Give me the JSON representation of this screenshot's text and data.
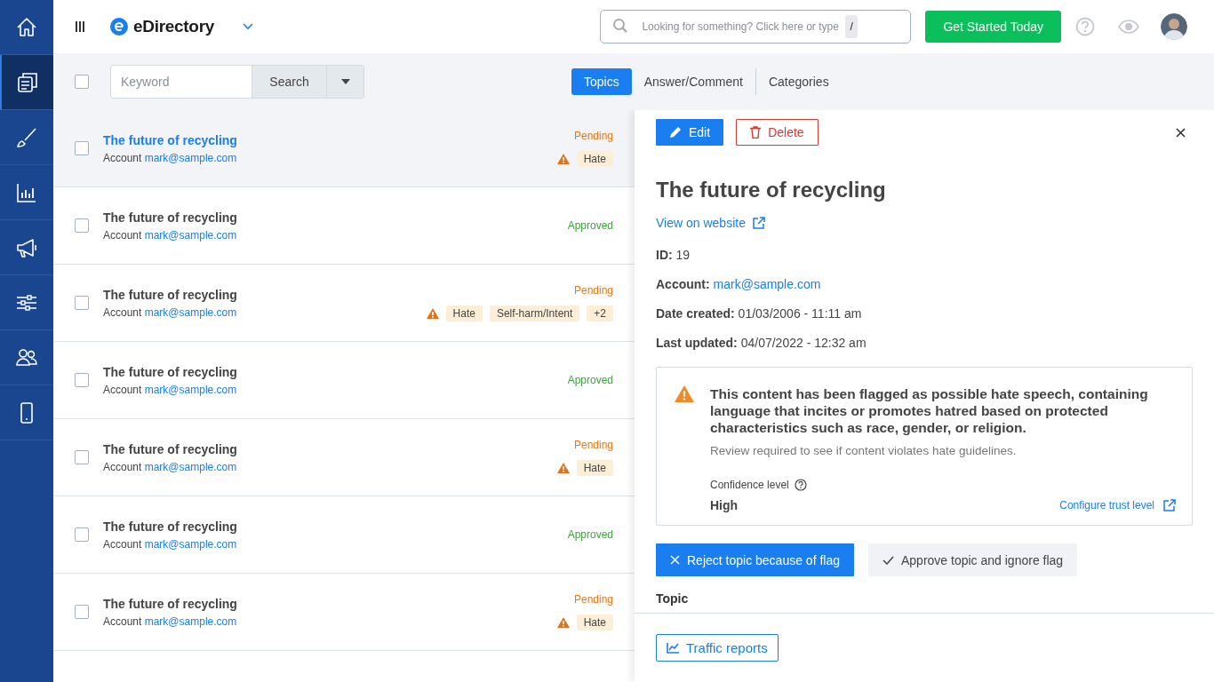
{
  "sidebar": {
    "items": [
      {
        "kind": "home",
        "selected": false
      },
      {
        "kind": "documents",
        "selected": true
      },
      {
        "kind": "brush",
        "selected": false
      },
      {
        "kind": "chart",
        "selected": false
      },
      {
        "kind": "megaphone",
        "selected": false
      },
      {
        "kind": "sliders",
        "selected": false
      },
      {
        "kind": "users",
        "selected": false
      },
      {
        "kind": "tablet",
        "selected": false
      }
    ]
  },
  "topbar": {
    "brand": "eDirectory",
    "search": {
      "placeholder": "Looking for something? Click here or type",
      "shortcut": "/"
    },
    "cta": "Get Started Today"
  },
  "toolbar": {
    "select_all": {
      "checked": false
    },
    "keyword": {
      "placeholder": "Keyword"
    },
    "search_button": "Search",
    "tabs": [
      {
        "label": "Topics",
        "selected": true
      },
      {
        "label": "Answer/Comment",
        "selected": false
      },
      {
        "label": "Categories",
        "selected": false
      }
    ]
  },
  "list": {
    "rows": [
      {
        "title": "The future of recycling",
        "account_label": "Account",
        "account": "mark@sample.com",
        "status": "Pending",
        "kind": "pending",
        "flags": [
          "Hate"
        ],
        "selected": true,
        "checked": false
      },
      {
        "title": "The future of recycling",
        "account_label": "Account",
        "account": "mark@sample.com",
        "status": "Approved",
        "kind": "approved",
        "selected": false,
        "checked": false
      },
      {
        "title": "The future of recycling",
        "account_label": "Account",
        "account": "mark@sample.com",
        "status": "Pending",
        "kind": "pending",
        "flags": [
          "Hate",
          "Self-harm/Intent",
          "+2"
        ],
        "selected": false,
        "checked": false
      },
      {
        "title": "The future of recycling",
        "account_label": "Account",
        "account": "mark@sample.com",
        "status": "Approved",
        "kind": "approved",
        "selected": false,
        "checked": false
      },
      {
        "title": "The future of recycling",
        "account_label": "Account",
        "account": "mark@sample.com",
        "status": "Pending",
        "kind": "pending",
        "flags": [
          "Hate"
        ],
        "selected": false,
        "checked": false
      },
      {
        "title": "The future of recycling",
        "account_label": "Account",
        "account": "mark@sample.com",
        "status": "Approved",
        "kind": "approved",
        "selected": false,
        "checked": false
      },
      {
        "title": "The future of recycling",
        "account_label": "Account",
        "account": "mark@sample.com",
        "status": "Pending",
        "kind": "pending",
        "flags": [
          "Hate"
        ],
        "selected": false,
        "checked": false
      }
    ]
  },
  "detail": {
    "edit": "Edit",
    "delete": "Delete",
    "title": "The future of recycling",
    "view_link": "View on website",
    "fields": [
      {
        "label": "ID:",
        "value": "19",
        "kind": "text"
      },
      {
        "label": "Account:",
        "value": "mark@sample.com",
        "kind": "link"
      },
      {
        "label": "Date created:",
        "value": "01/03/2006 - 11:11 am",
        "kind": "text"
      },
      {
        "label": "Last updated:",
        "value": "04/07/2022 - 12:32 am",
        "kind": "text"
      }
    ],
    "alert": {
      "message": "This content has been flagged as possible hate speech, containing language that incites or promotes hatred based on protected characteristics such as race, gender, or religion.",
      "note": "Review required to see if content violates hate guidelines.",
      "confidence_label": "Confidence level",
      "confidence": "High",
      "configure_link": "Configure trust level"
    },
    "reject": "Reject topic because of flag",
    "approve": "Approve topic and ignore flag",
    "section": "Topic",
    "footer_button": "Traffic reports"
  }
}
